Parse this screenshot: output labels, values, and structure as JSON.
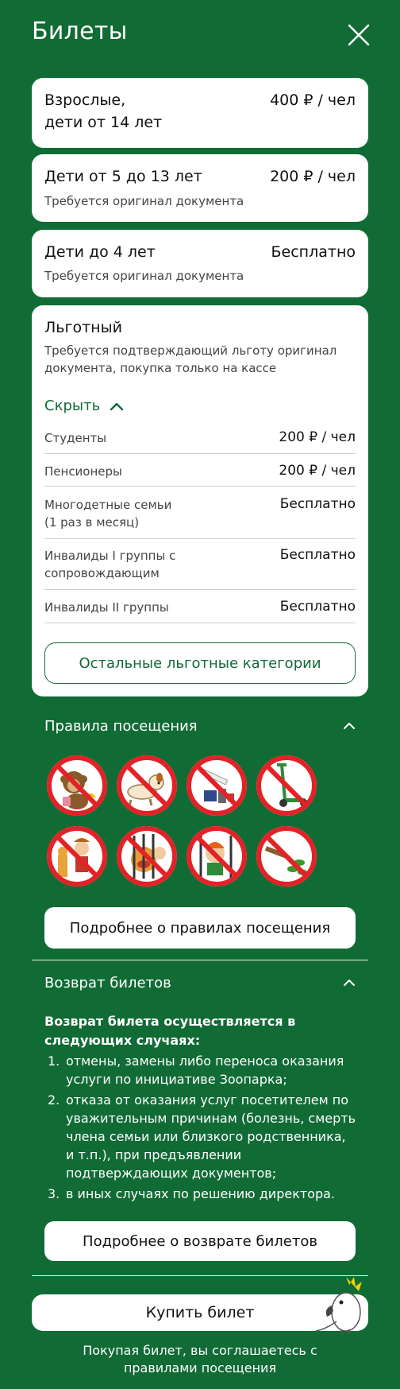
{
  "header": {
    "title": "Билеты"
  },
  "tickets": [
    {
      "name": "Взрослые,\nдети от 14 лет",
      "price": "400 ₽ / чел",
      "note": ""
    },
    {
      "name": "Дети от 5 до 13 лет",
      "price": "200 ₽ / чел",
      "note": "Требуется оригинал документа"
    },
    {
      "name": "Дети до 4 лет",
      "price": "Бесплатно",
      "note": "Требуется оригинал документа"
    }
  ],
  "benefit": {
    "name": "Льготный",
    "note": "Требуется подтверждающий льготу оригинал документа, покупка только на кассе",
    "toggle_label": "Скрыть",
    "rows": [
      {
        "label": "Студенты",
        "value": "200 ₽ / чел"
      },
      {
        "label": "Пенсионеры",
        "value": "200 ₽ / чел"
      },
      {
        "label": "Многодетные семьи\n(1 раз в месяц)",
        "value": "Бесплатно"
      },
      {
        "label": "Инвалиды I группы с сопровождающим",
        "value": "Бесплатно"
      },
      {
        "label": "Инвалиды II группы",
        "value": "Бесплатно"
      }
    ],
    "other_button": "Остальные льготные категории"
  },
  "rules": {
    "title": "Правила посещения",
    "icons": [
      "no-feeding-animals-icon",
      "no-pets-icon",
      "no-smoking-icon",
      "no-scooters-icon",
      "no-teasing-animals-icon",
      "no-climbing-enclosures-icon",
      "no-knocking-glass-icon",
      "no-breaking-plants-icon"
    ],
    "more_button": "Подробнее о правилах посещения"
  },
  "returns": {
    "title": "Возврат билетов",
    "intro": "Возврат билета осуществляется в следующих случаях:",
    "items": [
      "отмены, замены либо переноса оказания услуги по инициативе Зоопарка;",
      "отказа от оказания услуг посетителем по уважительным причинам (болезнь, смерть члена     семьи или близкого родственника, и т.п.), при предъявлении подтверждающих документов;",
      "в иных случаях по решению директора."
    ],
    "more_button": "Подробнее о возврате билетов"
  },
  "footer": {
    "buy_button": "Купить билет",
    "agree_text": "Покупая билет, вы соглашаетесь с правилами посещения"
  },
  "colors": {
    "brand_green": "#116b35",
    "prohibit_red": "#e32227"
  }
}
